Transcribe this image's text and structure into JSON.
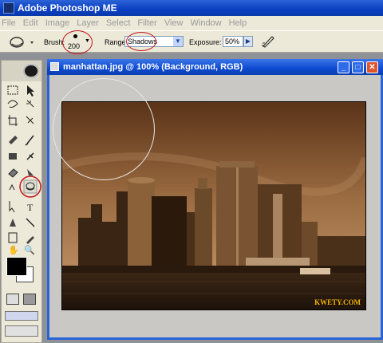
{
  "app": {
    "title": "Adobe Photoshop ME"
  },
  "menu": {
    "items": [
      "File",
      "Edit",
      "Image",
      "Layer",
      "Select",
      "Filter",
      "View",
      "Window",
      "Help"
    ]
  },
  "options": {
    "brush_label": "Brush:",
    "brush_size": "200",
    "range_label": "Range:",
    "range_value": "Shadows",
    "exposure_label": "Exposure:",
    "exposure_value": "50%"
  },
  "document": {
    "title": "manhattan.jpg @ 100% (Background, RGB)",
    "watermark": "KWETY.COM"
  },
  "colors": {
    "accent": "#0a3fc3",
    "highlight": "#c2171d",
    "sepia": "#7a4a22"
  },
  "icons": [
    "burn-tool-icon",
    "eyedropper-icon",
    "hand-icon",
    "zoom-icon",
    "minimize-icon",
    "maximize-icon",
    "close-icon"
  ]
}
